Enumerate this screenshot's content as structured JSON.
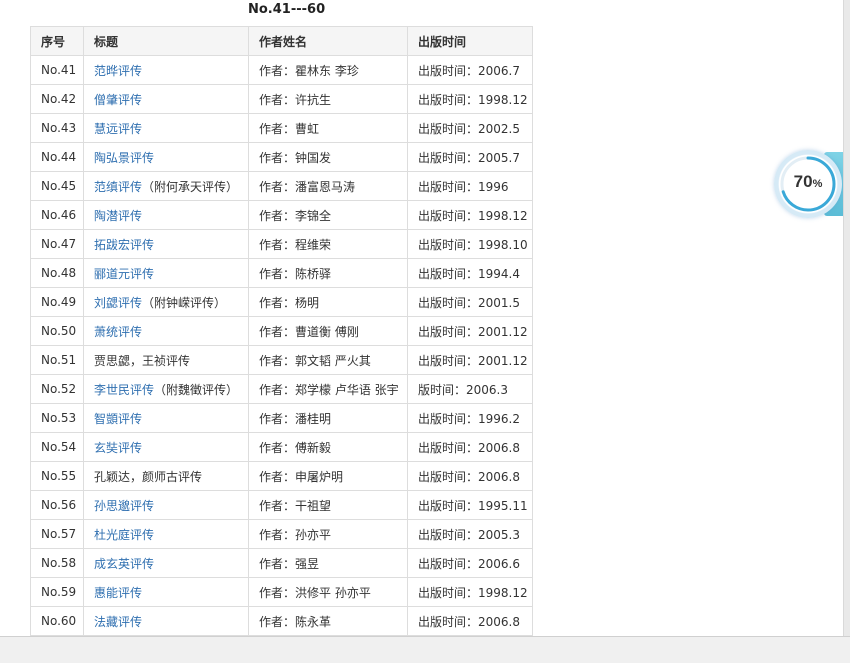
{
  "page": {
    "range_title": "No.41---60"
  },
  "table": {
    "headers": [
      "序号",
      "标题",
      "作者姓名",
      "出版时间"
    ],
    "rows": [
      {
        "no": "No.41",
        "title": "范晔评传",
        "suffix": "",
        "author": "作者：瞿林东 李珍",
        "date": "出版时间：2006.7",
        "linked": true
      },
      {
        "no": "No.42",
        "title": "僧肇评传",
        "suffix": "",
        "author": "作者：许抗生",
        "date": "出版时间：1998.12",
        "linked": true
      },
      {
        "no": "No.43",
        "title": "慧远评传",
        "suffix": "",
        "author": "作者：曹虹",
        "date": "出版时间：2002.5",
        "linked": true
      },
      {
        "no": "No.44",
        "title": "陶弘景评传",
        "suffix": "",
        "author": "作者：钟国发",
        "date": "出版时间：2005.7",
        "linked": true
      },
      {
        "no": "No.45",
        "title": "范缜评传",
        "suffix": "（附何承天评传）",
        "author": "作者：潘富恩马涛",
        "date": "出版时间：1996",
        "linked": true
      },
      {
        "no": "No.46",
        "title": "陶潜评传",
        "suffix": "",
        "author": "作者：李锦全",
        "date": "出版时间：1998.12",
        "linked": true
      },
      {
        "no": "No.47",
        "title": "拓跋宏评传",
        "suffix": "",
        "author": "作者：程维荣",
        "date": "出版时间：1998.10",
        "linked": true
      },
      {
        "no": "No.48",
        "title": "郦道元评传",
        "suffix": "",
        "author": "作者：陈桥驿",
        "date": "出版时间：1994.4",
        "linked": true
      },
      {
        "no": "No.49",
        "title": "刘勰评传",
        "suffix": "（附钟嵘评传）",
        "author": "作者：杨明",
        "date": "出版时间：2001.5",
        "linked": true
      },
      {
        "no": "No.50",
        "title": "萧统评传",
        "suffix": "",
        "author": "作者：曹道衡 傅刚",
        "date": "出版时间：2001.12",
        "linked": true
      },
      {
        "no": "No.51",
        "title": "贾思勰，王祯评传",
        "suffix": "",
        "author": "作者：郭文韬 严火其",
        "date": "出版时间：2001.12",
        "linked": false
      },
      {
        "no": "No.52",
        "title": "李世民评传",
        "suffix": "（附魏徵评传）",
        "author": "作者：郑学檬 卢华语 张宇",
        "date": "版时间：2006.3",
        "linked": true
      },
      {
        "no": "No.53",
        "title": "智顗评传",
        "suffix": "",
        "author": "作者：潘桂明",
        "date": "出版时间：1996.2",
        "linked": true
      },
      {
        "no": "No.54",
        "title": "玄奘评传",
        "suffix": "",
        "author": "作者：傅新毅",
        "date": "出版时间：2006.8",
        "linked": true
      },
      {
        "no": "No.55",
        "title": "孔颖达，颜师古评传",
        "suffix": "",
        "author": "作者：申屠炉明",
        "date": "出版时间：2006.8",
        "linked": false
      },
      {
        "no": "No.56",
        "title": "孙思邈评传",
        "suffix": "",
        "author": "作者：干祖望",
        "date": "出版时间：1995.11",
        "linked": true
      },
      {
        "no": "No.57",
        "title": "杜光庭评传",
        "suffix": "",
        "author": "作者：孙亦平",
        "date": "出版时间：2005.3",
        "linked": true
      },
      {
        "no": "No.58",
        "title": "成玄英评传",
        "suffix": "",
        "author": "作者：强昱",
        "date": "出版时间：2006.6",
        "linked": true
      },
      {
        "no": "No.59",
        "title": "惠能评传",
        "suffix": "",
        "author": "作者：洪修平 孙亦平",
        "date": "出版时间：1998.12",
        "linked": true
      },
      {
        "no": "No.60",
        "title": "法藏评传",
        "suffix": "",
        "author": "作者：陈永革",
        "date": "出版时间：2006.8",
        "linked": true
      }
    ]
  },
  "widget": {
    "value": "70",
    "unit": "%",
    "fraction": 0.7,
    "ring_color": "#3aa9d8"
  }
}
